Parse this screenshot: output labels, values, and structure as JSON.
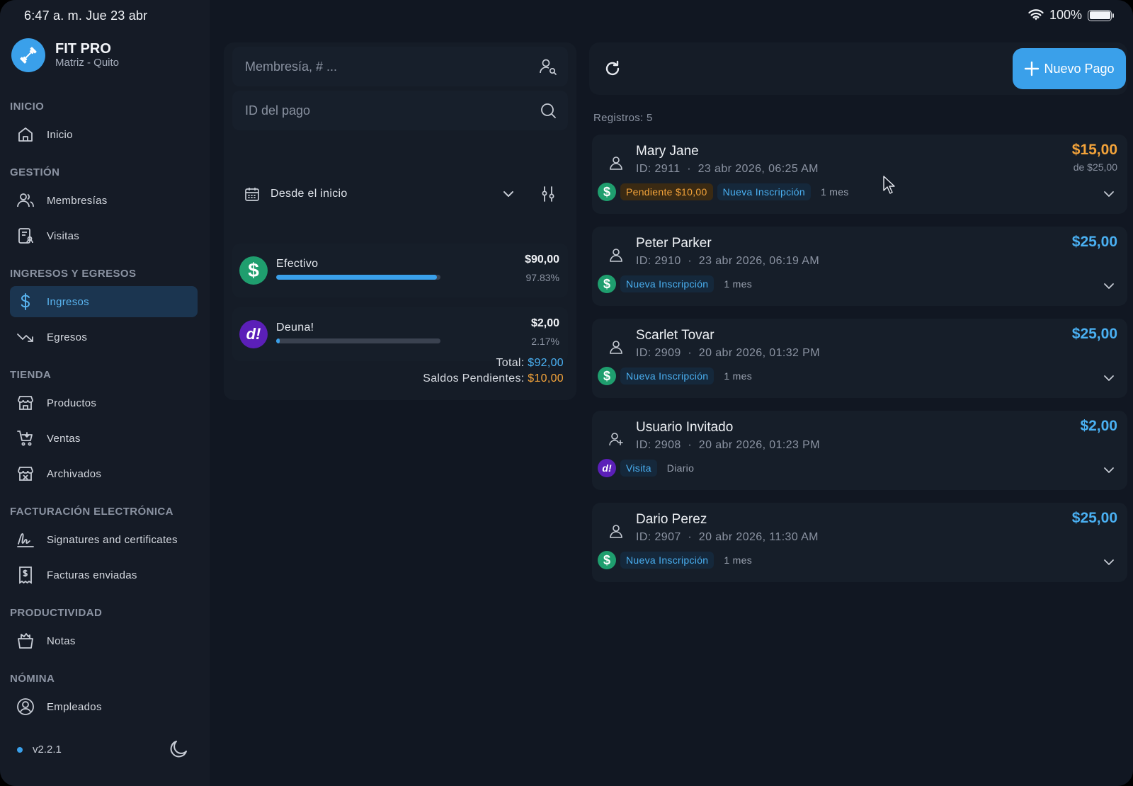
{
  "status": {
    "time": "6:47 a. m.   Jue 23 abr",
    "battery": "100%"
  },
  "brand": {
    "title": "FIT PRO",
    "subtitle": "Matriz - Quito"
  },
  "sidebar": {
    "sections": [
      {
        "title": "INICIO"
      },
      {
        "title": "GESTIÓN"
      },
      {
        "title": "INGRESOS Y EGRESOS"
      },
      {
        "title": "TIENDA"
      },
      {
        "title": "FACTURACIÓN ELECTRÓNICA"
      },
      {
        "title": "PRODUCTIVIDAD"
      },
      {
        "title": "NÓMINA"
      }
    ],
    "items": [
      {
        "label": "Inicio",
        "icon": "home-icon"
      },
      {
        "label": "Membresías",
        "icon": "users-icon"
      },
      {
        "label": "Visitas",
        "icon": "clipboard-user-icon"
      },
      {
        "label": "Ingresos",
        "icon": "dollar-icon",
        "active": true
      },
      {
        "label": "Egresos",
        "icon": "trend-down-icon"
      },
      {
        "label": "Productos",
        "icon": "store-icon"
      },
      {
        "label": "Ventas",
        "icon": "cart-icon"
      },
      {
        "label": "Archivados",
        "icon": "archive-store-icon"
      },
      {
        "label": "Signatures and certificates",
        "icon": "signature-icon"
      },
      {
        "label": "Facturas enviadas",
        "icon": "invoice-icon"
      },
      {
        "label": "Notas",
        "icon": "notes-icon"
      },
      {
        "label": "Empleados",
        "icon": "employee-icon"
      }
    ],
    "version": "v2.2.1"
  },
  "filters": {
    "membership_placeholder": "Membresía, # ...",
    "payment_id_placeholder": "ID del pago",
    "date_range": "Desde el inicio",
    "methods": [
      {
        "name": "Efectivo",
        "amount": "$90,00",
        "percent": "97.83%",
        "share": 0.9783,
        "color": "#1f9e6e",
        "icon": "dollar-icon"
      },
      {
        "name": "Deuna!",
        "amount": "$2,00",
        "percent": "2.17%",
        "share": 0.0217,
        "color": "#5b1fb8",
        "icon": "deuna-icon"
      }
    ],
    "total_label": "Total:",
    "total_value": "$92,00",
    "pending_label": "Saldos Pendientes:",
    "pending_value": "$10,00"
  },
  "payments": {
    "new_button": "Nuevo Pago",
    "records_label": "Registros: 5",
    "list": [
      {
        "name": "Mary Jane",
        "id": "ID: 2911",
        "date": "23 abr 2026, 06:25 AM",
        "amount": "$15,00",
        "of": "de $25,00",
        "method": "cash",
        "pending": "Pendiente $10,00",
        "type": "Nueva Inscripción",
        "period": "1 mes",
        "guest": false
      },
      {
        "name": "Peter Parker",
        "id": "ID: 2910",
        "date": "23 abr 2026, 06:19 AM",
        "amount": "$25,00",
        "of": "",
        "method": "cash",
        "pending": "",
        "type": "Nueva Inscripción",
        "period": "1 mes",
        "guest": false
      },
      {
        "name": "Scarlet Tovar",
        "id": "ID: 2909",
        "date": "20 abr 2026, 01:32 PM",
        "amount": "$25,00",
        "of": "",
        "method": "cash",
        "pending": "",
        "type": "Nueva Inscripción",
        "period": "1 mes",
        "guest": false
      },
      {
        "name": "Usuario Invitado",
        "id": "ID: 2908",
        "date": "20 abr 2026, 01:23 PM",
        "amount": "$2,00",
        "of": "",
        "method": "deuna",
        "pending": "",
        "type": "Visita",
        "period": "Diario",
        "guest": true
      },
      {
        "name": "Dario Perez",
        "id": "ID: 2907",
        "date": "20 abr 2026, 11:30 AM",
        "amount": "$25,00",
        "of": "",
        "method": "cash",
        "pending": "",
        "type": "Nueva Inscripción",
        "period": "1 mes",
        "guest": false
      }
    ]
  },
  "colors": {
    "accent": "#3aa0ea",
    "pending": "#f3a33a",
    "cash": "#1f9e6e",
    "deuna": "#5b1fb8"
  }
}
